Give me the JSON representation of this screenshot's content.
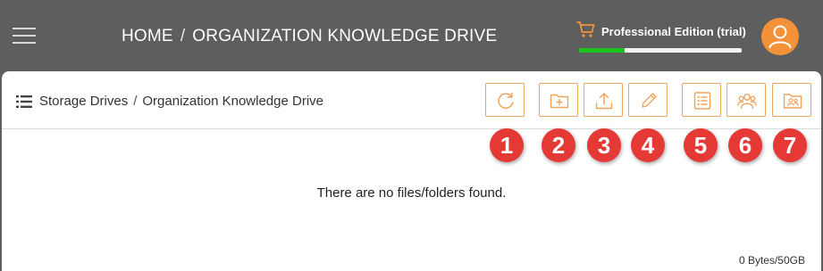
{
  "topbar": {
    "breadcrumb_home": "HOME",
    "breadcrumb_separator": "/",
    "breadcrumb_current": "ORGANIZATION KNOWLEDGE DRIVE",
    "edition_label": "Professional Edition (trial)",
    "trial_progress": 0.28,
    "progress_color": "#1ec21e",
    "accent_color": "#f4923a",
    "icons": [
      "hamburger-menu-icon",
      "cart-icon",
      "user-avatar-icon"
    ]
  },
  "panel": {
    "breadcrumb_root": "Storage Drives",
    "breadcrumb_separator": "/",
    "breadcrumb_current": "Organization Knowledge Drive",
    "toolbar": [
      {
        "icon": "refresh-icon",
        "marker": "1"
      },
      {
        "icon": "new-folder-icon",
        "marker": "2"
      },
      {
        "icon": "upload-icon",
        "marker": "3"
      },
      {
        "icon": "edit-pencil-icon",
        "marker": "4"
      },
      {
        "icon": "details-list-icon",
        "marker": "5"
      },
      {
        "icon": "users-group-icon",
        "marker": "6"
      },
      {
        "icon": "shared-folder-users-icon",
        "marker": "7"
      }
    ],
    "marker_color": "#e53935",
    "empty_message": "There are no files/folders found.",
    "storage_usage": "0 Bytes/50GB"
  }
}
